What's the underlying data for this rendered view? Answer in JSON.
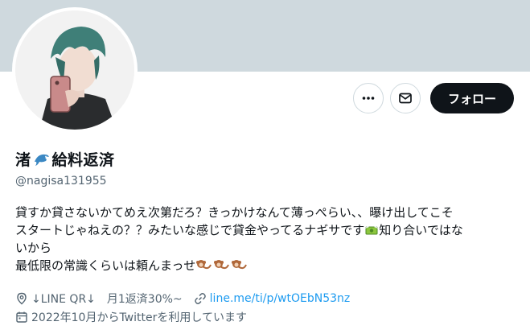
{
  "profile": {
    "display_name": "渚",
    "display_name_suffix": "給料返済",
    "name_emoji": "dolphin-icon",
    "handle": "@nagisa131955",
    "bio_line1": "貸すか貸さないかてめえ次第だろ？きっかけなんて薄っぺらい、、曝け出してこそ",
    "bio_line2a": "スタートじゃねえの？？みたいな感じで貸金やってるナギサです",
    "bio_line2_emoji": "money-with-wings-icon",
    "bio_line2b": "知り合いではな",
    "bio_line3": "いから",
    "bio_line4": "最低限の常識くらいは頼んまっせ",
    "bio_line4_emoji": "monkey-icon",
    "location": "↓LINE QR↓　月1返済30%~",
    "url": "line.me/ti/p/wtOEbN53nz",
    "joined": "2022年10月からTwitterを利用しています"
  },
  "actions": {
    "more_icon": "more-icon",
    "message_icon": "message-icon",
    "follow_label": "フォロー"
  },
  "colors": {
    "banner": "#cfd9de",
    "link": "#1d9bf0",
    "secondary_text": "#536471",
    "follow_bg": "#0f1419"
  }
}
